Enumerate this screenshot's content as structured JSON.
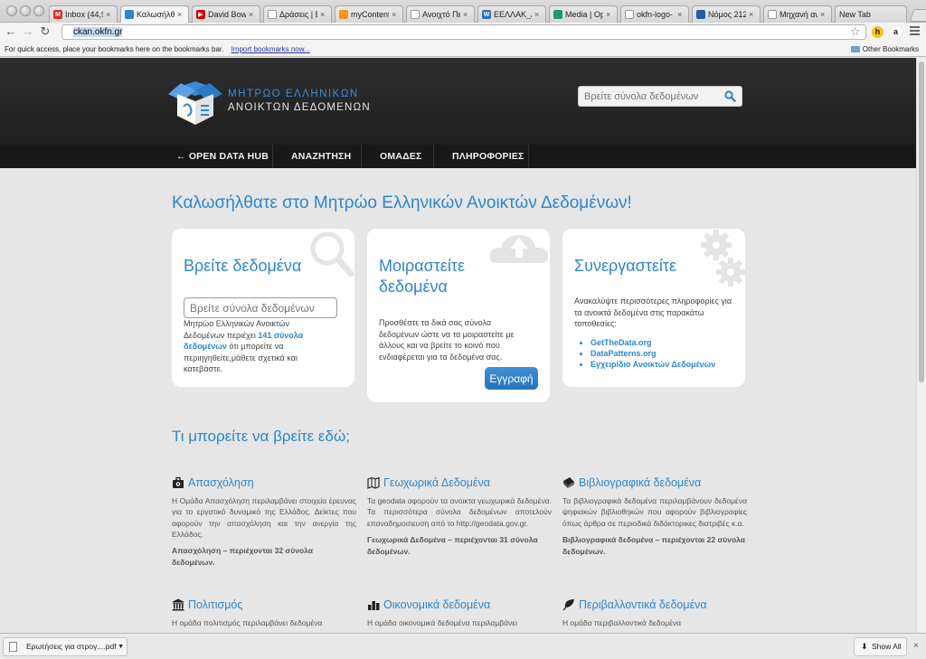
{
  "browser": {
    "tabs": [
      {
        "title": "Inbox (44,9",
        "favicon_color": "#d93025",
        "favicon_glyph": "M",
        "active": false
      },
      {
        "title": "Καλωσήλθα",
        "favicon_color": "#2b86d1",
        "favicon_glyph": "",
        "active": true
      },
      {
        "title": "David Bowie",
        "favicon_color": "#cc0000",
        "favicon_glyph": "▶",
        "active": false
      },
      {
        "title": "Δράσεις | Ε",
        "favicon_color": "#ffffff",
        "favicon_glyph": "",
        "active": false
      },
      {
        "title": "myContent",
        "favicon_color": "#f7931e",
        "favicon_glyph": "",
        "active": false
      },
      {
        "title": "Ανοιχτό Πε",
        "favicon_color": "#ffffff",
        "favicon_glyph": "",
        "active": false
      },
      {
        "title": "ΕΕΛΛΑΚ_Αν",
        "favicon_color": "#2a6ebb",
        "favicon_glyph": "W",
        "active": false
      },
      {
        "title": "Media | Op",
        "favicon_color": "#1a9a6c",
        "favicon_glyph": "",
        "active": false
      },
      {
        "title": "okfn-logo-",
        "favicon_color": "#ffffff",
        "favicon_glyph": "",
        "active": false
      },
      {
        "title": "Νόμος 212",
        "favicon_color": "#1d5fa8",
        "favicon_glyph": "",
        "active": false
      },
      {
        "title": "Μηχανή αν",
        "favicon_color": "#ffffff",
        "favicon_glyph": "",
        "active": false
      },
      {
        "title": "New Tab",
        "favicon_color": "",
        "favicon_glyph": "",
        "active": false
      }
    ],
    "tab_close_glyph": "×",
    "url": "ckan.okfn.gr",
    "bookmarks_prompt": "For quick access, place your bookmarks here on the bookmarks bar.",
    "bookmarks_import_link": "Import bookmarks now...",
    "other_bookmarks": "Other Bookmarks",
    "nav_glyphs": {
      "back": "←",
      "forward": "→",
      "reload": "↻",
      "star": "☆"
    },
    "extensions": [
      {
        "glyph": "h",
        "bg": "#f5c518",
        "fg": "#222"
      },
      {
        "glyph": "a",
        "bg": "#ffffff",
        "fg": "#222"
      }
    ]
  },
  "site": {
    "logo_line1": "ΜΗΤΡΩΟ ΕΛΛΗΝΙΚΩΝ",
    "logo_line2": "ΑΝΟΙΚΤΩΝ ΔΕΔΟΜΕΝΩΝ",
    "search_placeholder": "Βρείτε σύνολα δεδομένων",
    "nav": [
      "← OPEN DATA HUB",
      "ΑΝΑΖΗΤΗΣΗ",
      "ΟΜΑΔΕΣ",
      "ΠΛΗΡΟΦΟΡΙΕΣ"
    ],
    "welcome": "Καλωσήλθατε στο Μητρώο Ελληνικών Ανοικτών Δεδομένων!",
    "cards": {
      "find": {
        "title": "Βρείτε δεδομένα",
        "input_placeholder": "Βρείτε σύνολα δεδομένων",
        "text_before": "Μητρώο Ελληνικών Ανοικτών Δεδομένων περιέχει ",
        "text_link": "141 σύνολα δεδομένων",
        "text_after": " ότι μπορείτε να περιηγηθείτε,μάθετε σχετικά και κατεβάστε."
      },
      "share": {
        "title": "Μοιραστείτε δεδομένα",
        "text": "Προσθέστε τα δικά σας σύνολα δεδομένων ώστε να τα μοιραστείτε με άλλους και να βρείτε το κοινό που ενδιαφέρεται για τα δεδομένα σας.",
        "button": "Εγγραφή"
      },
      "collaborate": {
        "title": "Συνεργαστείτε",
        "text": "Ανακαλύψτε περισσότερες πληροφορίες για τα ανοικτά δεδομένα στις παρακάτω τοποθεσίες:",
        "links": [
          "GetTheData.org",
          "DataPatterns.org",
          "Εγχειρίδιο Ανοικτών Δεδομένων"
        ]
      }
    },
    "find_here": "Τι μπορείτε να βρείτε εδώ;",
    "categories": [
      {
        "title": "Απασχόληση",
        "icon": "briefcase-icon",
        "desc": "Η Ομάδα Απασχόληση περιλαμβάνει στοιχεία έρευνας για το εργατικό δυναμικό της Ελλάδος. Δείκτες που αφορούν την απασχόληση και την ανεργία της Ελλάδος.",
        "count": "Απασχόληση – περιέχονται 32 σύνολα δεδομένων."
      },
      {
        "title": "Γεωχωρικά Δεδομένα",
        "icon": "map-icon",
        "desc": "Τα geodata αφορούν τα ανοικτα γεωχωρικά δεδομένα. Τα περισσότερα σύνολα δεδομένων αποτελούν επαναδημοσιευση από το http://geodata.gov.gr.",
        "count": "Γεωχωρικά Δεδομένα – περιέχονται 31 σύνολα δεδομένων."
      },
      {
        "title": "Βιβλιογραφικά δεδομένα",
        "icon": "book-icon",
        "desc": "Τα βιβλιογραφικά δεδομένα περιλαμβάνουν δεδομένα ψηφιακών βιβλιοθηκών που αφορούν βιβλιογραφίες όπως άρθρα σε περιοδικά διδάκτορικες διατριβές κ.α.",
        "count": "Βιβλιογραφικά δεδομένα – περιέχονται 22 σύνολα δεδομένων."
      },
      {
        "title": "Πολιτισμός",
        "icon": "museum-icon",
        "desc": "Η ομάδα πολιτισμός περιλαμβάνει δεδομένα",
        "count": ""
      },
      {
        "title": "Οικονομικά δεδομένα",
        "icon": "bar-chart-icon",
        "desc": "Η ομάδα οικονομικά δεδομένα περιλαμβάνει",
        "count": ""
      },
      {
        "title": "Περιβαλλοντικά δεδομένα",
        "icon": "leaf-icon",
        "desc": "Η ομάδα περιβαλλοντικά δεδομένα",
        "count": ""
      }
    ]
  },
  "downloads": {
    "file": "Ερωτήσεις για στρογ....pdf",
    "show_all": "Show All",
    "close_glyph": "×"
  },
  "colors": {
    "accent": "#2b86d1",
    "header_bg": "#262626",
    "nav_bg": "#181818",
    "page_bg": "#e6e6e6"
  }
}
